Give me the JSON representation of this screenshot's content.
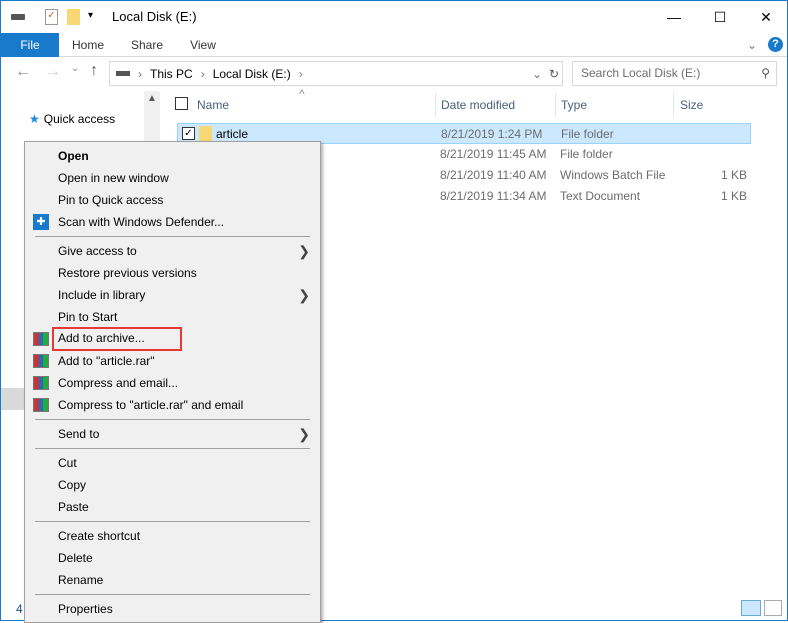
{
  "window": {
    "title": "Local Disk (E:)",
    "minimize": "—",
    "maximize": "☐",
    "close": "✕"
  },
  "ribbon": {
    "tabs": [
      "File",
      "Home",
      "Share",
      "View"
    ],
    "help": "?",
    "expand": "⌄"
  },
  "address": {
    "crumbs": [
      "This PC",
      "Local Disk (E:)"
    ],
    "search_placeholder": "Search Local Disk (E:)"
  },
  "sidebar": {
    "quick_access": "Quick access",
    "status_count": "4"
  },
  "columns": [
    "Name",
    "Date modified",
    "Type",
    "Size"
  ],
  "files": [
    {
      "name": "article",
      "date": "8/21/2019 1:24 PM",
      "type": "File folder",
      "size": "",
      "selected": true
    },
    {
      "name": "",
      "date": "8/21/2019 11:45 AM",
      "type": "File folder",
      "size": ""
    },
    {
      "name": "",
      "date": "8/21/2019 11:40 AM",
      "type": "Windows Batch File",
      "size": "1 KB"
    },
    {
      "name": "",
      "date": "8/21/2019 11:34 AM",
      "type": "Text Document",
      "size": "1 KB"
    }
  ],
  "menu": {
    "open": "Open",
    "open_new": "Open in new window",
    "pin_quick": "Pin to Quick access",
    "scan": "Scan with Windows Defender...",
    "give_access": "Give access to",
    "restore": "Restore previous versions",
    "include": "Include in library",
    "pin_start": "Pin to Start",
    "add_archive": "Add to archive...",
    "add_rar": "Add to \"article.rar\"",
    "compress_email": "Compress and email...",
    "compress_rar_email": "Compress to \"article.rar\" and email",
    "send_to": "Send to",
    "cut": "Cut",
    "copy": "Copy",
    "paste": "Paste",
    "create_shortcut": "Create shortcut",
    "delete": "Delete",
    "rename": "Rename",
    "properties": "Properties"
  },
  "colors": {
    "accent": "#1979ca",
    "highlight": "#e53935",
    "selection": "#cce8ff"
  }
}
